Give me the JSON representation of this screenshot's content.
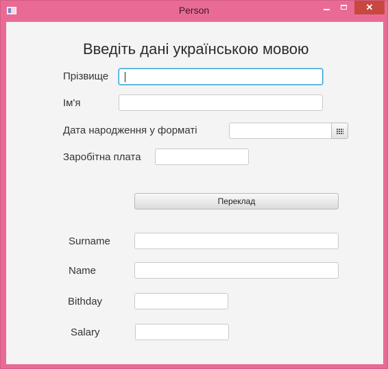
{
  "window": {
    "title": "Person"
  },
  "form_ua": {
    "heading": "Введіть дані українською мовою",
    "surname_label": "Прізвище",
    "surname_value": "",
    "name_label": "Ім'я",
    "name_value": "",
    "birth_label": "Дата народження у форматі",
    "birth_value": "",
    "salary_label": "Заробітна плата",
    "salary_value": ""
  },
  "translate_button": "Переклад",
  "form_en": {
    "surname_label": "Surname",
    "surname_value": "",
    "name_label": "Name",
    "name_value": "",
    "birthday_label": "Bithday",
    "birthday_value": "",
    "salary_label": "Salary",
    "salary_value": ""
  },
  "icons": {
    "app": "app-window-icon",
    "minimize": "minimize-icon",
    "maximize": "maximize-icon",
    "close": "close-icon",
    "calendar": "calendar-icon"
  },
  "colors": {
    "window_frame": "#e96b95",
    "focus_border": "#2ea2d8",
    "close_button": "#c7483f",
    "content_bg": "#f4f4f4"
  }
}
